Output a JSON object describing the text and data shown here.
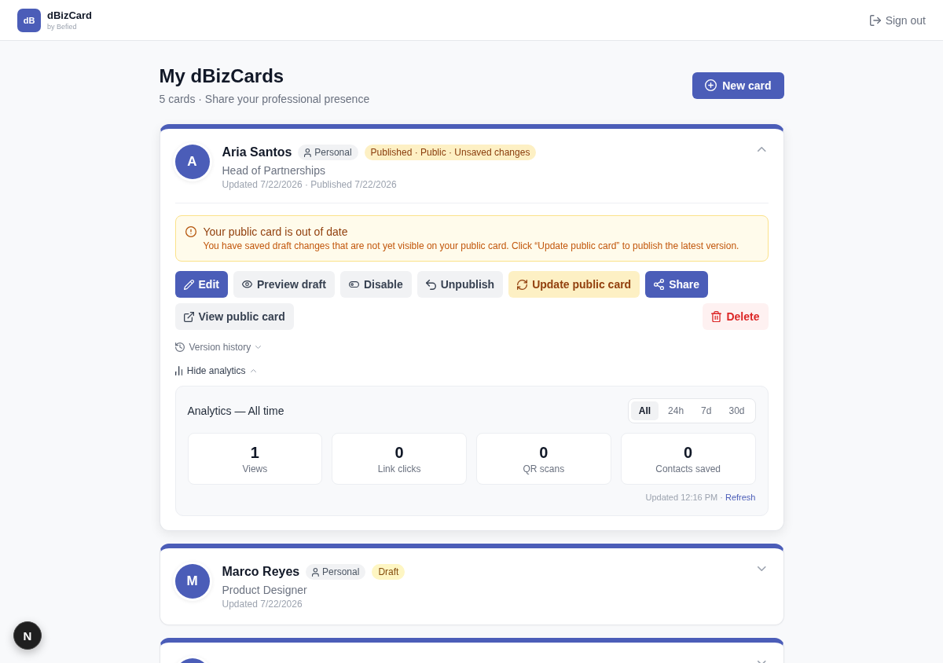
{
  "header": {
    "logo": "dB",
    "app_name": "dBizCard",
    "byline": "by Befied",
    "sign_out": "Sign out"
  },
  "page": {
    "title": "My dBizCards",
    "subtitle": "5 cards · Share your professional presence",
    "new_card": "New card"
  },
  "cards": [
    {
      "initial": "A",
      "name": "Aria Santos",
      "type": "Personal",
      "status": {
        "label": "Published · Public · Unsaved changes",
        "kind": "unsaved"
      },
      "role": "Head of Partnerships",
      "meta": "Updated 7/22/2026 · Published 7/22/2026",
      "expanded": true,
      "alert": {
        "title": "Your public card is out of date",
        "message": "You have saved draft changes that are not yet visible on your public card. Click “Update public card” to publish the latest version."
      },
      "action_rows": [
        [
          {
            "label": "Edit",
            "kind": "edit"
          },
          {
            "label": "Preview draft",
            "kind": "preview"
          },
          {
            "label": "Disable",
            "kind": "disable"
          },
          {
            "label": "Unpublish",
            "kind": "unpublish"
          },
          {
            "label": "Update public card",
            "kind": "update"
          },
          {
            "label": "Share",
            "kind": "share"
          }
        ],
        [
          {
            "label": "View public card",
            "kind": "view"
          }
        ]
      ],
      "delete": {
        "label": "Delete",
        "kind": "delete"
      },
      "version_history": {
        "label": "Version history",
        "expanded": false
      },
      "analytics_toggle": {
        "label": "Hide analytics",
        "expanded": true
      },
      "analytics": {
        "title": "Analytics — All time",
        "ranges": [
          {
            "label": "All",
            "selected": true
          },
          {
            "label": "24h",
            "selected": false
          },
          {
            "label": "7d",
            "selected": false
          },
          {
            "label": "30d",
            "selected": false
          }
        ],
        "stats": [
          {
            "value": "1",
            "label": "Views"
          },
          {
            "value": "0",
            "label": "Link clicks"
          },
          {
            "value": "0",
            "label": "QR scans"
          },
          {
            "value": "0",
            "label": "Contacts saved"
          }
        ],
        "updated": "Updated 12:16 PM ·",
        "refresh": "Refresh"
      }
    },
    {
      "initial": "M",
      "name": "Marco Reyes",
      "type": "Personal",
      "status": {
        "label": "Draft",
        "kind": "draft"
      },
      "role": "Product Designer",
      "meta": "Updated 7/22/2026",
      "expanded": false
    },
    {
      "expanded": false
    }
  ],
  "dev_indicator": {
    "label": "N"
  }
}
